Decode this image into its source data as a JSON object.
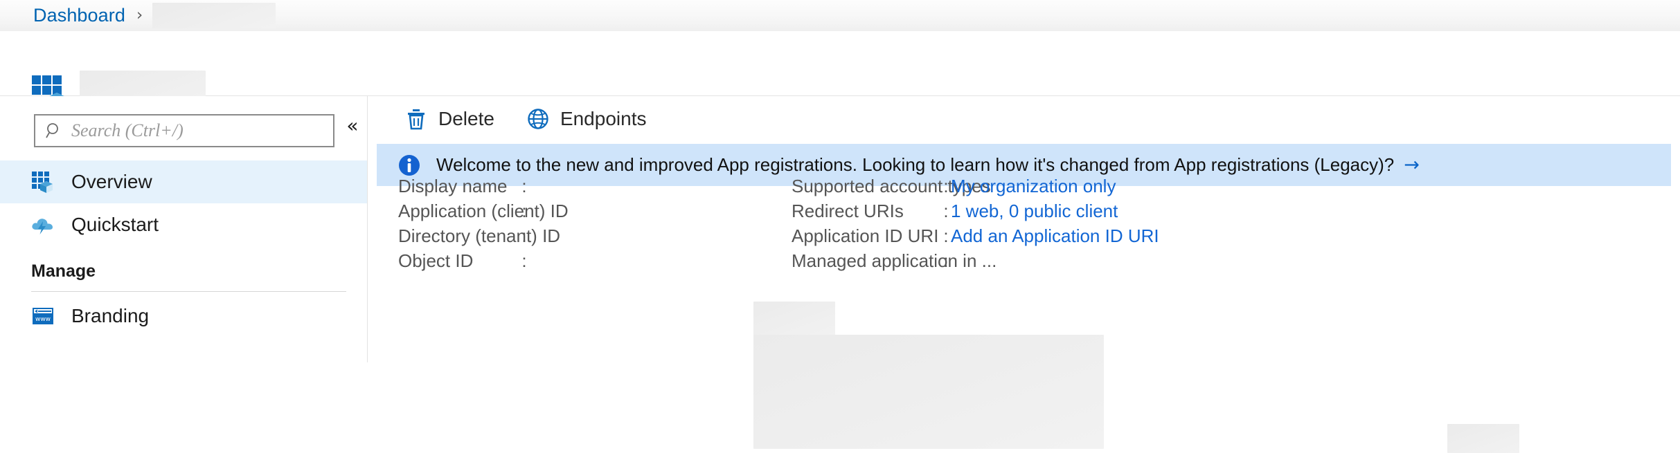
{
  "breadcrumb": {
    "root_label": "Dashboard",
    "separator": "›",
    "redacted_crumb": ""
  },
  "header": {
    "logo_icon": "app-registration-icon",
    "redacted_title": ""
  },
  "sidebar": {
    "search": {
      "icon": "search-icon",
      "placeholder": "Search (Ctrl+/)",
      "value": ""
    },
    "collapse_icon": "chevron-double-left-icon",
    "items": [
      {
        "label": "Overview",
        "icon": "app-registration-icon",
        "active": true
      },
      {
        "label": "Quickstart",
        "icon": "cloud-lightning-icon",
        "active": false
      }
    ],
    "groups": [
      {
        "title": "Manage",
        "items": [
          {
            "label": "Branding",
            "icon": "www-browser-icon",
            "active": false
          }
        ]
      }
    ]
  },
  "toolbar": {
    "delete_label": "Delete",
    "delete_icon": "trash-icon",
    "endpoints_label": "Endpoints",
    "endpoints_icon": "globe-icon"
  },
  "banner": {
    "icon": "info-icon",
    "text": "Welcome to the new and improved App registrations. Looking to learn how it's changed from App registrations (Legacy)?",
    "arrow": "→",
    "background": "#cfe4fa"
  },
  "properties": {
    "left": [
      {
        "label": "Display name",
        "colon": ":",
        "value": "",
        "redacted": true
      },
      {
        "label": "Application (client) ID",
        "colon": ":",
        "value": "",
        "redacted": true
      },
      {
        "label": "Directory (tenant) ID",
        "colon": ":",
        "value": "",
        "redacted": true
      },
      {
        "label": "Object ID",
        "colon": ":",
        "value": "",
        "redacted": true
      }
    ],
    "right": [
      {
        "label": "Supported account types",
        "colon": ":",
        "value": "My organization only",
        "link": true,
        "redacted": false
      },
      {
        "label": "Redirect URIs",
        "colon": ":",
        "value": "1 web, 0 public client",
        "link": true,
        "redacted": false
      },
      {
        "label": "Application ID URI",
        "colon": ":",
        "value": "Add an Application ID URI",
        "link": true,
        "redacted": false
      },
      {
        "label": "Managed application in ...",
        "colon": ":",
        "value": "",
        "link": false,
        "redacted": true
      }
    ]
  },
  "colors": {
    "link": "#1266d4",
    "breadcrumb_link": "#0063b1",
    "accent": "#0078d4",
    "nav_active_bg": "#e5f2fc",
    "banner_bg": "#cfe4fa",
    "label_text": "#555555"
  }
}
